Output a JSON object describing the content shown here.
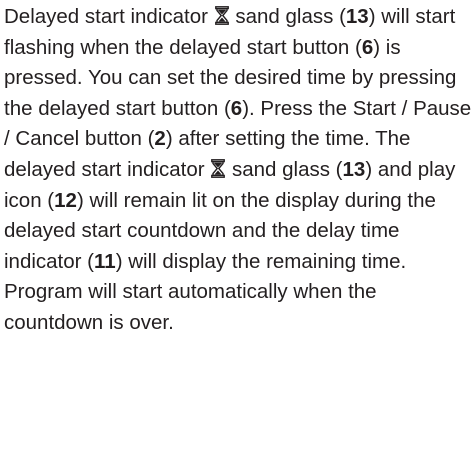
{
  "paragraph": {
    "s1_a": "Delayed start indicator",
    "s1_b": "sand glass (",
    "ref_13a": "13",
    "s1_c": ") will start flashing when the delayed start button (",
    "ref_6a": "6",
    "s1_d": ") is pressed. You can set the desired time by pressing the delayed start button (",
    "ref_6b": "6",
    "s1_e": "). Press the Start / Pause / Cancel button (",
    "ref_2": "2",
    "s1_f": ") after setting the time. The delayed start indicator",
    "s1_g": "sand glass (",
    "ref_13b": "13",
    "s1_h": ") and play icon (",
    "ref_12": "12",
    "s1_i": ") will remain lit on the display during the delayed start countdown and the delay time indicator (",
    "ref_11": "11",
    "s1_j": ") will display the remaining time. Program will start automatically when the countdown is over."
  },
  "icons": {
    "sand_glass": "hourglass-icon"
  }
}
